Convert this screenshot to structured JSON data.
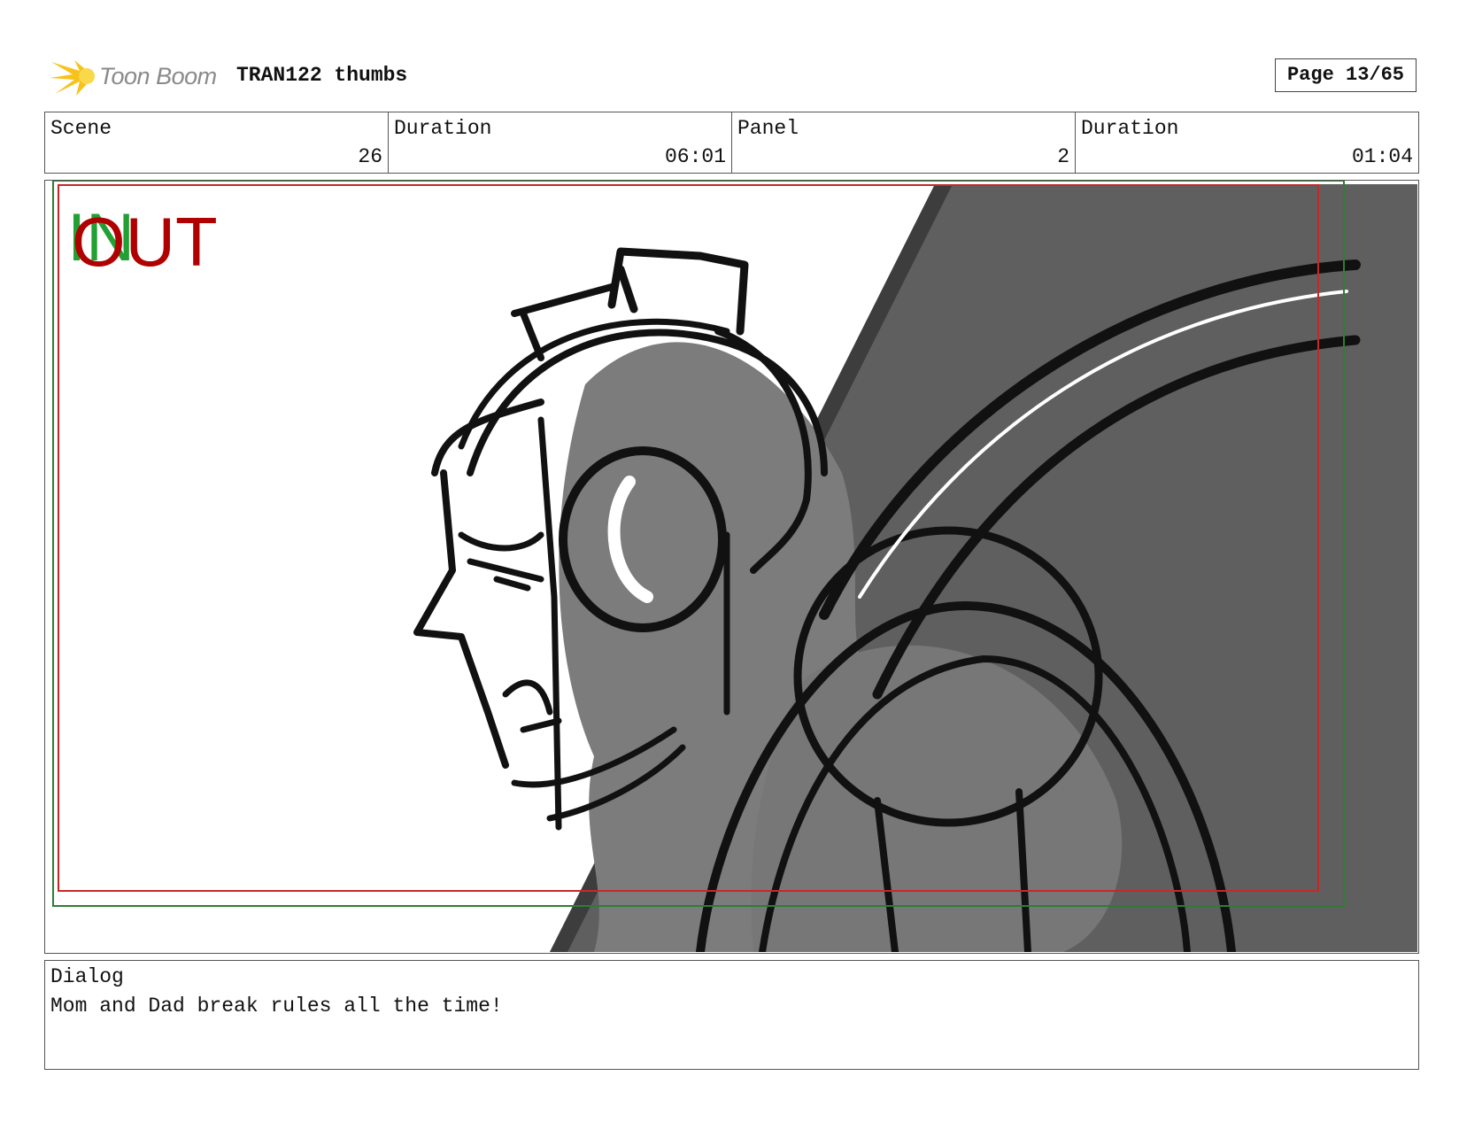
{
  "header": {
    "logo_text": "Toon Boom",
    "title": "TRAN122 thumbs",
    "page_indicator": "Page 13/65"
  },
  "info": {
    "scene_label": "Scene",
    "scene_value": "26",
    "scene_duration_label": "Duration",
    "scene_duration_value": "06:01",
    "panel_label": "Panel",
    "panel_value": "2",
    "panel_duration_label": "Duration",
    "panel_duration_value": "01:04"
  },
  "panel": {
    "in_marker": "IN",
    "out_marker": "OUT",
    "in_color": "#22a033",
    "out_color": "#b00000",
    "safe_green": "#2e7d32",
    "safe_red": "#c62828"
  },
  "dialog": {
    "label": "Dialog",
    "text": "Mom and Dad break rules all the time!"
  }
}
